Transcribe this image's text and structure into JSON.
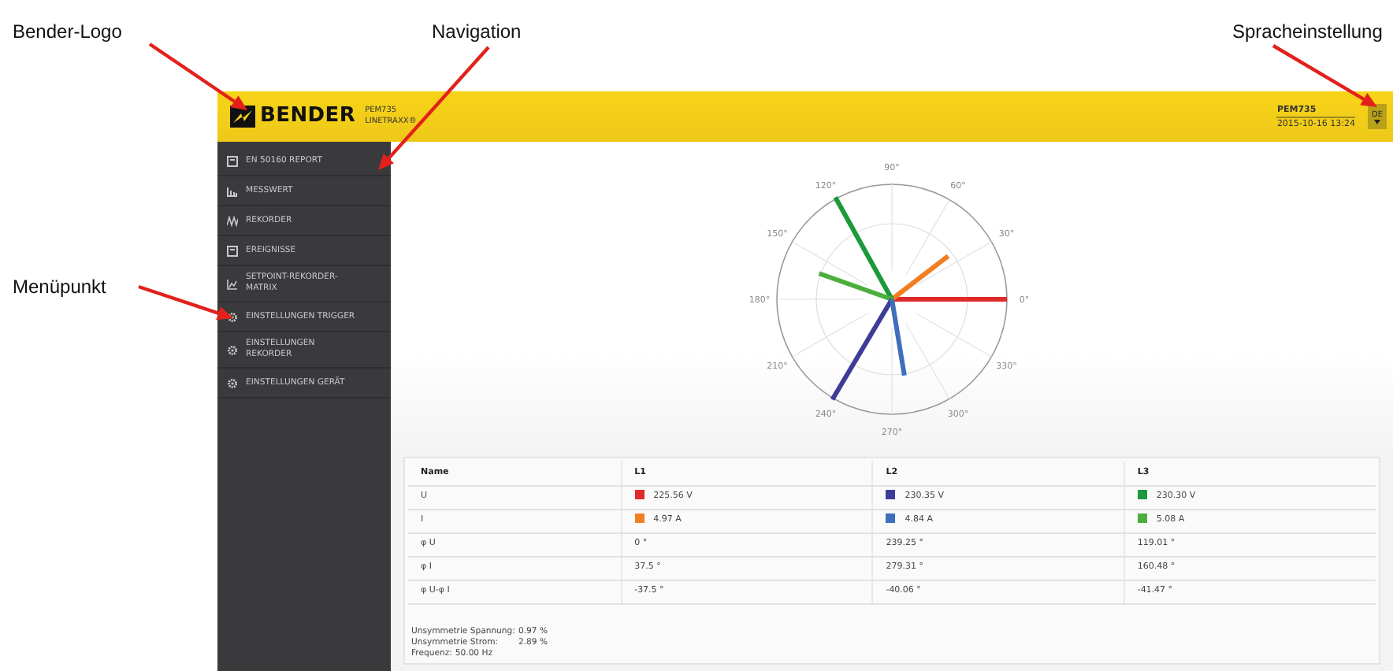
{
  "annotations": [
    {
      "label": "Bender-Logo",
      "kind": "logo"
    },
    {
      "label": "Navigation",
      "kind": "navigation"
    },
    {
      "label": "Spracheinstellung",
      "kind": "language"
    },
    {
      "label": "Menüpunkt",
      "kind": "menu"
    }
  ],
  "header": {
    "logo_text": "BENDER",
    "device": "PEM735",
    "product": "LINETRAXX®",
    "device_name": "PEM735",
    "datetime": "2015-10-16 13:24",
    "language": "DE"
  },
  "sidebar": {
    "items": [
      {
        "label": "EN 50160 REPORT",
        "kind": "report"
      },
      {
        "label": "MESSWERT",
        "kind": "bars"
      },
      {
        "label": "REKORDER",
        "kind": "waves"
      },
      {
        "label": "EREIGNISSE",
        "kind": "report"
      },
      {
        "label": "SETPOINT-REKORDER-MATRIX",
        "kind": "matrix"
      },
      {
        "label": "EINSTELLUNGEN TRIGGER",
        "kind": "gear"
      },
      {
        "label": "EINSTELLUNGEN REKORDER",
        "kind": "gear"
      },
      {
        "label": "EINSTELLUNGEN GERÄT",
        "kind": "gear"
      }
    ]
  },
  "phasor_diagram": {
    "angle_labels": [
      "0°",
      "30°",
      "60°",
      "90°",
      "120°",
      "150°",
      "180°",
      "210°",
      "240°",
      "270°",
      "300°",
      "330°"
    ]
  },
  "table": {
    "columns": [
      "Name",
      "L1",
      "L2",
      "L3"
    ],
    "rows": [
      [
        {
          "text": "U"
        },
        {
          "text": "225.56 V",
          "color": "#e02a2a"
        },
        {
          "text": "230.35 V",
          "color": "#3d3d99"
        },
        {
          "text": "230.30 V",
          "color": "#1a9a3a"
        }
      ],
      [
        {
          "text": "I"
        },
        {
          "text": "4.97 A",
          "color": "#f07f22"
        },
        {
          "text": "4.84 A",
          "color": "#3f6fba"
        },
        {
          "text": "5.08 A",
          "color": "#4cae3c"
        }
      ],
      [
        {
          "text": "φ U"
        },
        {
          "text": "0 °"
        },
        {
          "text": "239.25 °"
        },
        {
          "text": "119.01 °"
        }
      ],
      [
        {
          "text": "φ I"
        },
        {
          "text": "37.5 °"
        },
        {
          "text": "279.31 °"
        },
        {
          "text": "160.48 °"
        }
      ],
      [
        {
          "text": "φ U-φ I"
        },
        {
          "text": "-37.5  °"
        },
        {
          "text": "-40.06  °"
        },
        {
          "text": "-41.47  °"
        }
      ]
    ]
  },
  "footer": [
    {
      "label": "Unsymmetrie Spannung:",
      "value": "0.97 %"
    },
    {
      "label": "Unsymmetrie Strom:",
      "value": "2.89 %"
    },
    {
      "label": "Frequenz:",
      "value": "50.00 Hz"
    }
  ]
}
